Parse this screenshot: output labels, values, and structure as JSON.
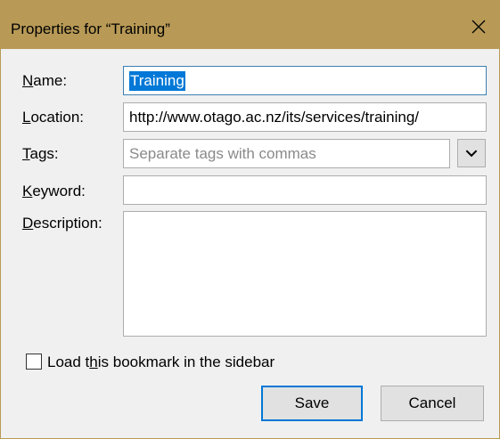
{
  "window": {
    "title": "Properties for “Training”",
    "close_icon": "close-icon"
  },
  "form": {
    "name": {
      "label_key": "N",
      "label_rest": "ame:",
      "value": "Training"
    },
    "location": {
      "label_key": "L",
      "label_rest": "ocation:",
      "value": "http://www.otago.ac.nz/its/services/training/"
    },
    "tags": {
      "label_key": "T",
      "label_rest": "ags:",
      "value": "",
      "placeholder": "Separate tags with commas",
      "dropdown_icon": "chevron-down-icon"
    },
    "keyword": {
      "label_key": "K",
      "label_rest": "eyword:",
      "value": ""
    },
    "description": {
      "label_key": "D",
      "label_rest": "escription:",
      "value": ""
    }
  },
  "sidebar_option": {
    "label_pre": "Load t",
    "label_key": "h",
    "label_post": "is bookmark in the sidebar",
    "checked": false
  },
  "buttons": {
    "save_label": "Save",
    "cancel_label": "Cancel"
  },
  "colors": {
    "titlebar": "#b89a56",
    "selection": "#0078d7",
    "focus_border": "#3c7fb1"
  }
}
